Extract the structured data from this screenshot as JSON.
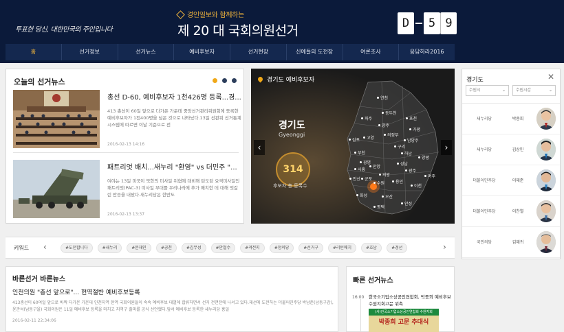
{
  "header": {
    "slogan": "투표한 당신, 대한민국의 주인입니다",
    "sub_title": "경인일보와 함께하는",
    "main_title": "제 20 대 국회의원선거",
    "dday": {
      "label": "D",
      "tens": "5",
      "ones": "9"
    },
    "colors": {
      "bg": "#0b1a3a",
      "accent": "#f0b43c"
    }
  },
  "nav": {
    "items": [
      "홈",
      "선거정보",
      "선거뉴스",
      "예비후보자",
      "선거현장",
      "신예들의 도전장",
      "여론조사",
      "응답하라2016"
    ]
  },
  "news": {
    "title": "오늘의 선거뉴스",
    "items": [
      {
        "headline": "총선 D-60, 예비후보자 1천426명 등록...경...",
        "desc": "413 총선이 60일 앞으로 다가온 가운데 중앙선거관리위원회에 등록한 예비후보자가 1천400명을 넘은 것으로 나타났다.13일 선관위 선거통계시스템에 따르면 이날 기준으로 전",
        "date": "2016-02-13 14:16"
      },
      {
        "headline": "패트리엇 배치...새누리 \"환영\" vs 더민주 \"...",
        "desc": "여야는 13일 미국이 북한의 미사일 위협에 대비해 탄도탄 요격미사일인 패트리엇(PAC-3) 미사일 부대를 우리나라에 추가 배치한 데 대해 엇갈린 반응을 내놨다.새누리당은 한반도",
        "date": "2016-02-13 13:37"
      }
    ]
  },
  "map": {
    "title": "경기도 예비후보자",
    "region": "경기도",
    "region_en": "Gyeonggi",
    "count": "314",
    "count_label": "후보자 총 등록수",
    "cities": [
      "연천",
      "포천",
      "동두천",
      "파주",
      "양주",
      "의정부",
      "가평",
      "고양",
      "김포",
      "남양주",
      "구리",
      "하남",
      "부천",
      "양평",
      "광명",
      "시흥",
      "안양",
      "성남",
      "광주",
      "여주",
      "안산",
      "군포",
      "의왕",
      "용인",
      "이천",
      "화성",
      "수원",
      "오산",
      "안성",
      "평택"
    ]
  },
  "candidates": {
    "title": "경기도",
    "select_city": "수원시",
    "select_district": "수원시갑",
    "rows": [
      {
        "party": "새누리당",
        "name": "박종희"
      },
      {
        "party": "새누리당",
        "name": "김상민"
      },
      {
        "party": "더불어민주당",
        "name": "이재준"
      },
      {
        "party": "더불어민주당",
        "name": "이찬열"
      },
      {
        "party": "국민의당",
        "name": "김재귀"
      }
    ]
  },
  "keywords": {
    "label": "키워드",
    "tags": [
      "#도전합니다",
      "#새누리",
      "#문재인",
      "#공천",
      "#김무성",
      "#안철수",
      "#격전지",
      "#정의당",
      "#선거구",
      "#리턴매치",
      "#호남",
      "#경선"
    ]
  },
  "bareun": {
    "title": "바른선거 바른뉴스",
    "headline": "인천의원 \"총선 앞으로\"... 현역절반 예비후보등록",
    "desc": "413총선이 60여일 앞으로 바짝 다가온 가운데 인천지역 현역 국회의원들이 속속 예비후보 대열에 합류하면서 선거 전면전에 나서고 있다.재선에 도전하는 더불어민주당 박남춘(남동구갑), 윤관석(남동구을) 국회의원은 11일 예비후보 등록을 마치고 지역구 출마를 공식 선언했다.앞서 예비후보 등록한 새누리당 홍일",
    "date": "2016-02-11 22:34:06"
  },
  "fast": {
    "title": "빠른 선거뉴스",
    "time": "16:00",
    "headline": "한국소기업소상공인연합회, 박종희 예비후보 수원지회고문 위촉",
    "img_top": "(사)한국소기업소상공인연합회 수원지회",
    "img_main": "박종희 고문 추대식"
  }
}
